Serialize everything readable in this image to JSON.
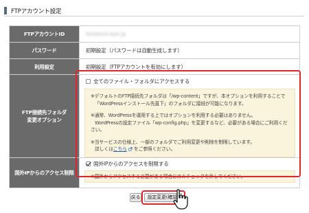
{
  "header": {
    "title": "FTPアカウント設定"
  },
  "rows": {
    "account_id": {
      "label": "FTPアカウントID",
      "value": "testdoud.wpx.jp"
    },
    "password": {
      "label": "パスワード",
      "value": "初期設定（パスワードは自動生成します）"
    },
    "usage": {
      "label": "利用設定",
      "value": "初期設定（FTPアカウントを有効にします）"
    },
    "access_folder": {
      "label_line1": "FTP接続先フォルダ",
      "label_line2": "変更オプション",
      "checkbox_label": "全てのファイル・フォルダにアクセスする",
      "checked": false,
      "note1_line1": "※デフォルトのFTP接続先フォルダは「/wp-content」ですが、本オプションを利用することで",
      "note1_line2": "「WordPressインストール先直下」のフォルダに接続が可能になります。",
      "note2_line1": "※通常、WordPressを運用する上ではオプションを利用する必要はありません。",
      "note2_line2": "WordPressの設定ファイル「wp-config.php」を変更するなど、必要がある場合にご利用ください。",
      "note3_line1": "※当サービスの仕様上、一部のフォルダでご利用変更や削除を制限しています。",
      "note3_prefix": "詳しくは",
      "note3_link": "こちら",
      "note3_suffix": "をご参照ください。"
    },
    "foreign_ip": {
      "label": "国外IPからのアクセス制限",
      "checkbox_label": "国外IPからのアクセスを制限する",
      "checked": true,
      "note": "※国外からアクセスする必要がある場合にのみチェックを外してください。"
    }
  },
  "buttons": {
    "back": "戻る",
    "confirm": "設定変更(確認)"
  },
  "colors": {
    "highlight": "#e3242b",
    "header_cell": "#6a6a6a",
    "note_bg": "#fbf4dc"
  }
}
